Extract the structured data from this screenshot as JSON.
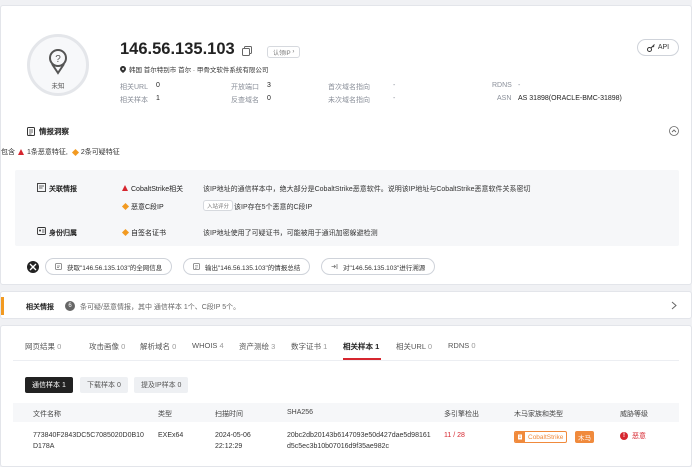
{
  "header": {
    "ip": "146.56.135.103",
    "claim_label": "认领IP",
    "location": "韩国 首尔特别市 首尔 · 甲骨文软件系统有限公司",
    "api_label": "API",
    "avatar_label": "未知",
    "stats": [
      {
        "label": "相关URL",
        "value": "0"
      },
      {
        "label": "开放端口",
        "value": "3"
      },
      {
        "label": "首次域名指向",
        "value": "-"
      },
      {
        "label": "RDNS",
        "value": "-"
      },
      {
        "label": "相关样本",
        "value": "1"
      },
      {
        "label": "反查域名",
        "value": "0"
      },
      {
        "label": "未次域名指向",
        "value": "-"
      },
      {
        "label": "ASN",
        "value": "AS 31898(ORACLE-BMC-31898)"
      }
    ]
  },
  "insight": {
    "title": "情报洞察",
    "summary_prefix": "包含",
    "malicious": "1条恶意特征,",
    "suspicious": "2条可疑特征",
    "groups": [
      {
        "title": "关联情报",
        "rows": [
          {
            "tag": "CobaltStrike相关",
            "desc": "该IP地址的通信样本中，绝大部分是CobaltStrike恶意软件。说明该IP地址与CobaltStrike恶意软件关系密切"
          },
          {
            "tag": "恶意C段IP",
            "chip": "入站评分",
            "desc": "该IP存在5个恶意的C段IP"
          }
        ]
      },
      {
        "title": "身份归属",
        "rows": [
          {
            "tag": "自签名证书",
            "desc": "该IP地址使用了可疑证书，可能被用于通讯加密躲避检测"
          }
        ]
      }
    ],
    "actions": [
      "获取\"146.56.135.103\"的全网信息",
      "输出\"146.56.135.103\"的情报总结",
      "对\"146.56.135.103\"进行溯源"
    ]
  },
  "related": {
    "title": "相关情报",
    "badge": "6",
    "text": "条可疑/恶意情报，其中 通信样本 1个、C段IP 5个。"
  },
  "tabs": [
    {
      "label": "网页结果",
      "count": "0"
    },
    {
      "label": "攻击画像",
      "count": "0"
    },
    {
      "label": "解析域名",
      "count": "0"
    },
    {
      "label": "WHOIS",
      "count": "4"
    },
    {
      "label": "资产测绘",
      "count": "3"
    },
    {
      "label": "数字证书",
      "count": "1"
    },
    {
      "label": "相关样本",
      "count": "1"
    },
    {
      "label": "相关URL",
      "count": "0"
    },
    {
      "label": "RDNS",
      "count": "0"
    }
  ],
  "subtabs": [
    "通信样本 1",
    "下载样本 0",
    "提及IP样本 0"
  ],
  "table": {
    "headers": [
      "文件名称",
      "类型",
      "扫描时间",
      "SHA256",
      "多引擎检出",
      "木马家族和类型",
      "威胁等级"
    ],
    "rows": [
      {
        "name_line1": "773840F2843DC5C7085020D0B10",
        "name_line2": "D178A",
        "type": "EXEx64",
        "date": "2024-05-06",
        "time": "22:12:29",
        "sha_line1": "20bc2db20143b6147093e50d427dae5d98161",
        "sha_line2": "d5c5ec3b10b07016d9f35ae982c",
        "detect": "11 / 28",
        "family": "CobaltStrike",
        "family_type": "木马",
        "level": "恶意"
      }
    ]
  },
  "colors": {
    "accent": "#d6262f",
    "orange": "#f29a21",
    "malware": "#f08a3c"
  }
}
